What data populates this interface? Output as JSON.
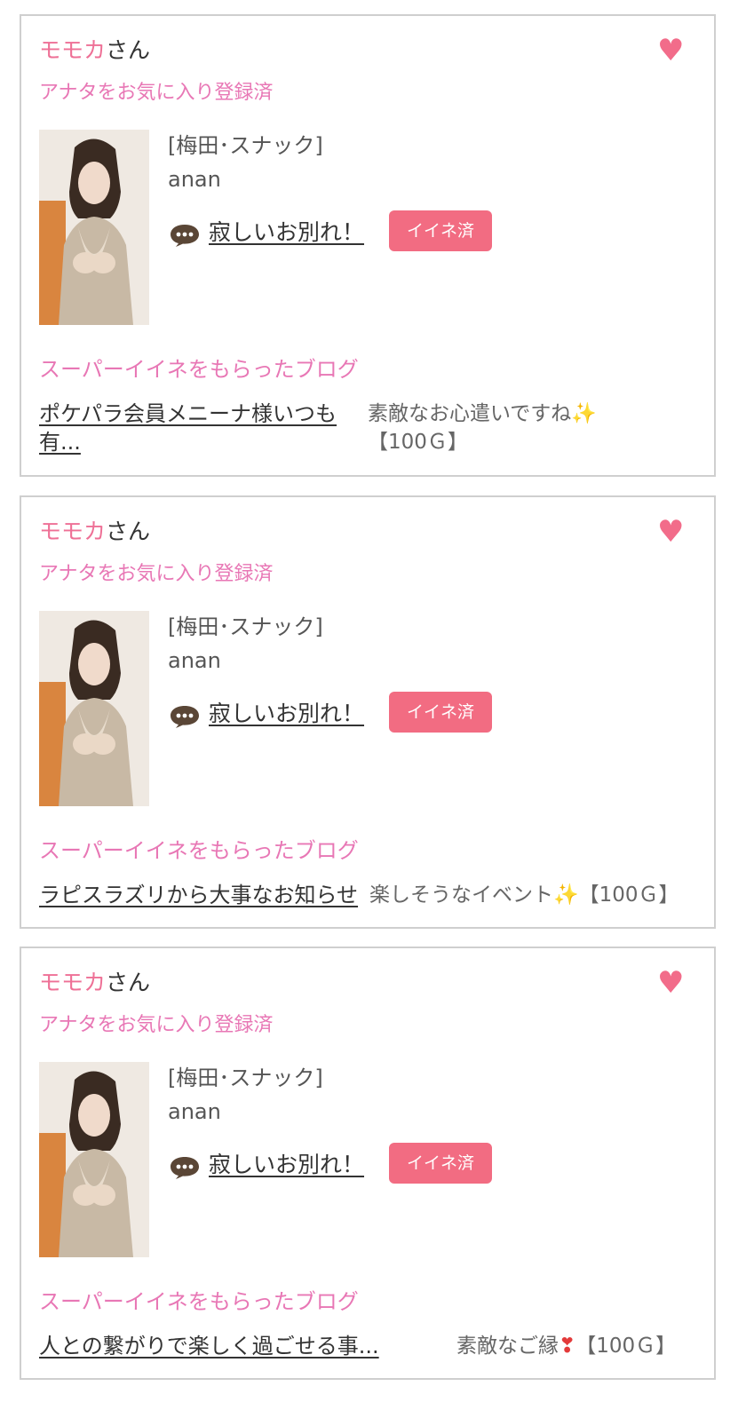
{
  "cards": [
    {
      "user_name": "モモカ",
      "honorific": "さん",
      "favorite_status": "アナタをお気に入り登録済",
      "shop": "[梅田･スナック]",
      "cast": "anan",
      "blog_title": "寂しいお別れ！",
      "like_button": "イイネ済",
      "super_like_label": "スーパーイイネをもらったブログ",
      "received_blog": "ポケパラ会員メニーナ様いつも有...",
      "comment_text": "素敵なお心遣いですね",
      "comment_emoji": "✨",
      "comment_points": "【100Ｇ】"
    },
    {
      "user_name": "モモカ",
      "honorific": "さん",
      "favorite_status": "アナタをお気に入り登録済",
      "shop": "[梅田･スナック]",
      "cast": "anan",
      "blog_title": "寂しいお別れ！",
      "like_button": "イイネ済",
      "super_like_label": "スーパーイイネをもらったブログ",
      "received_blog": "ラピスラズリから大事なお知らせ",
      "comment_text": "楽しそうなイベント",
      "comment_emoji": "✨",
      "comment_points": "【100Ｇ】"
    },
    {
      "user_name": "モモカ",
      "honorific": "さん",
      "favorite_status": "アナタをお気に入り登録済",
      "shop": "[梅田･スナック]",
      "cast": "anan",
      "blog_title": "寂しいお別れ！",
      "like_button": "イイネ済",
      "super_like_label": "スーパーイイネをもらったブログ",
      "received_blog": "人との繋がりで楽しく過ごせる事...",
      "comment_text": "素敵なご縁",
      "comment_emoji": "❣",
      "comment_points": "【100Ｇ】"
    }
  ],
  "icons": {
    "heart": "heart-icon",
    "bubble": "speech-bubble-icon"
  },
  "colors": {
    "accent_pink": "#ee7096",
    "button_pink": "#f26c82",
    "label_pink": "#e877b5",
    "heart_pink": "#f26c8a",
    "bubble_brown": "#5a4636"
  }
}
